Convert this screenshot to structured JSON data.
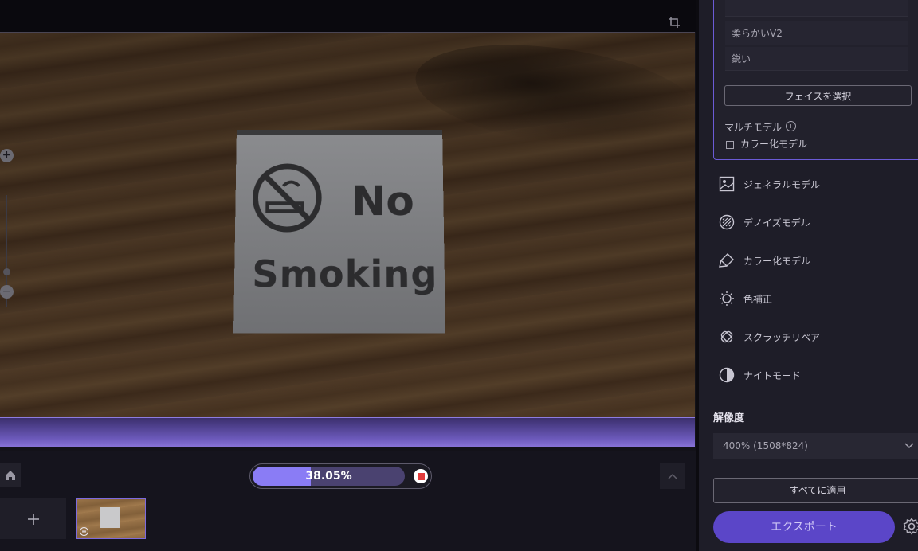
{
  "editor": {
    "progress": {
      "percent": 38.05,
      "label": "38.05%"
    },
    "preview_sign": {
      "line1": "No",
      "line2": "Smoking"
    }
  },
  "panel": {
    "face_options": [
      "柔らかいV2",
      "鋭い"
    ],
    "face_select_button": "フェイスを選択",
    "multi_model_label": "マルチモデル",
    "color_checkbox_label": "カラー化モデル",
    "models": [
      {
        "label": "ジェネラルモデル",
        "icon": "image-icon"
      },
      {
        "label": "デノイズモデル",
        "icon": "denoise-icon"
      },
      {
        "label": "カラー化モデル",
        "icon": "brush-icon"
      },
      {
        "label": "色補正",
        "icon": "sun-icon"
      },
      {
        "label": "スクラッチリペア",
        "icon": "bandage-icon"
      },
      {
        "label": "ナイトモード",
        "icon": "half-circle-icon"
      }
    ],
    "resolution_label": "解像度",
    "resolution_value": "400% (1508*824)",
    "apply_all_button": "すべてに適用",
    "export_button": "エクスポート"
  },
  "colors": {
    "accent": "#8a7cf5",
    "export": "#5b46c8",
    "stop": "#e23b3b"
  }
}
